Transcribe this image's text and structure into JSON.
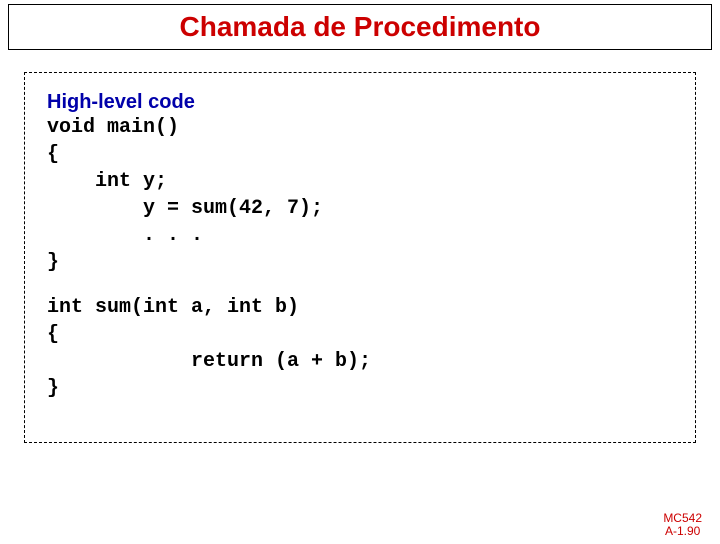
{
  "title": "Chamada de Procedimento",
  "section_label": "High-level code",
  "code_block_1": "void main()\n{\n    int y;\n        y = sum(42, 7);\n        . . .\n}",
  "code_block_2": "int sum(int a, int b)\n{\n            return (a + b);\n}",
  "footer": {
    "line1": "MC542",
    "line2": "A-1.90"
  }
}
